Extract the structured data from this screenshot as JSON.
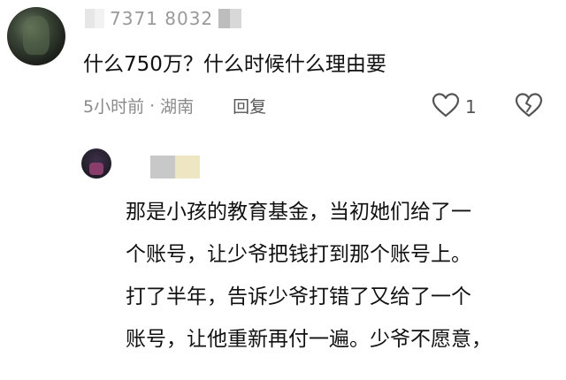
{
  "comment": {
    "uid_fragment": "7371 8032",
    "text": "什么750万？什么时候什么理由要",
    "time": "5小时前",
    "separator": "·",
    "location": "湖南",
    "reply_label": "回复",
    "like_count": "1",
    "icons": {
      "like": "heart-outline-icon",
      "dislike": "broken-heart-icon"
    }
  },
  "reply": {
    "lines": [
      "那是小孩的教育基金，当初她们给了一",
      "个账号，让少爷把钱打到那个账号上。",
      "打了半年，告诉少爷打错了又给了一个",
      "账号，让他重新再付一遍。少爷不愿意，"
    ]
  },
  "colors": {
    "text": "#111111",
    "meta": "#8a8a8a",
    "icon": "#555555"
  }
}
